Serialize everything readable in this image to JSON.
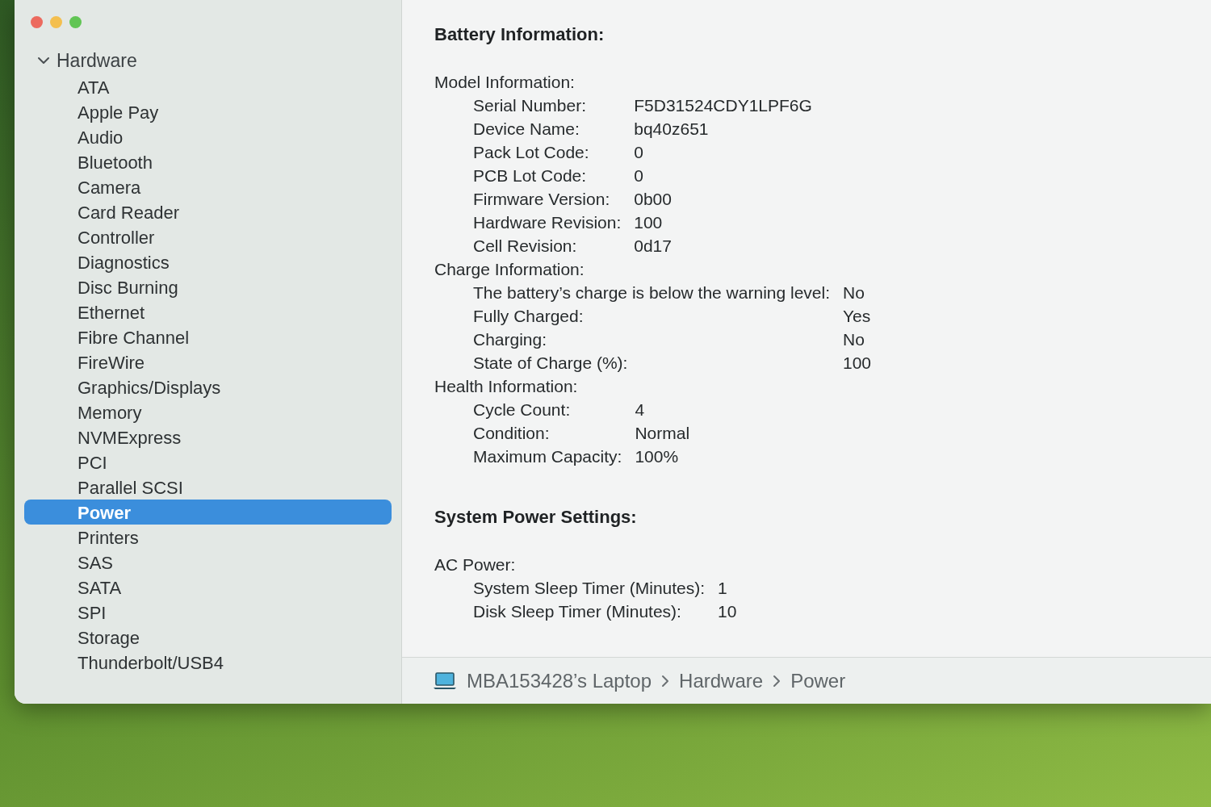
{
  "window_buttons": [
    {
      "color": "#ec6a5e"
    },
    {
      "color": "#f4bf4f"
    },
    {
      "color": "#61c554"
    }
  ],
  "sidebar": {
    "section": {
      "label": "Hardware",
      "expanded": true,
      "children": [
        {
          "label": "ATA",
          "selected": false
        },
        {
          "label": "Apple Pay",
          "selected": false
        },
        {
          "label": "Audio",
          "selected": false
        },
        {
          "label": "Bluetooth",
          "selected": false
        },
        {
          "label": "Camera",
          "selected": false
        },
        {
          "label": "Card Reader",
          "selected": false
        },
        {
          "label": "Controller",
          "selected": false
        },
        {
          "label": "Diagnostics",
          "selected": false
        },
        {
          "label": "Disc Burning",
          "selected": false
        },
        {
          "label": "Ethernet",
          "selected": false
        },
        {
          "label": "Fibre Channel",
          "selected": false
        },
        {
          "label": "FireWire",
          "selected": false
        },
        {
          "label": "Graphics/Displays",
          "selected": false
        },
        {
          "label": "Memory",
          "selected": false
        },
        {
          "label": "NVMExpress",
          "selected": false
        },
        {
          "label": "PCI",
          "selected": false
        },
        {
          "label": "Parallel SCSI",
          "selected": false
        },
        {
          "label": "Power",
          "selected": true
        },
        {
          "label": "Printers",
          "selected": false
        },
        {
          "label": "SAS",
          "selected": false
        },
        {
          "label": "SATA",
          "selected": false
        },
        {
          "label": "SPI",
          "selected": false
        },
        {
          "label": "Storage",
          "selected": false
        },
        {
          "label": "Thunderbolt/USB4",
          "selected": false
        }
      ]
    }
  },
  "details": {
    "sections": [
      {
        "title": "Battery Information:",
        "groups": [
          {
            "label": "Model Information:",
            "rows": [
              {
                "label": "Serial Number:",
                "value": "F5D31524CDY1LPF6G"
              },
              {
                "label": "Device Name:",
                "value": "bq40z651"
              },
              {
                "label": "Pack Lot Code:",
                "value": "0"
              },
              {
                "label": "PCB Lot Code:",
                "value": "0"
              },
              {
                "label": "Firmware Version:",
                "value": "0b00"
              },
              {
                "label": "Hardware Revision:",
                "value": "100"
              },
              {
                "label": "Cell Revision:",
                "value": "0d17"
              }
            ]
          },
          {
            "label": "Charge Information:",
            "rows": [
              {
                "label": "The battery’s charge is below the warning level:",
                "value": "No"
              },
              {
                "label": "Fully Charged:",
                "value": "Yes"
              },
              {
                "label": "Charging:",
                "value": "No"
              },
              {
                "label": "State of Charge (%):",
                "value": "100"
              }
            ]
          },
          {
            "label": "Health Information:",
            "rows": [
              {
                "label": "Cycle Count:",
                "value": "4"
              },
              {
                "label": "Condition:",
                "value": "Normal"
              },
              {
                "label": "Maximum Capacity:",
                "value": "100%"
              }
            ]
          }
        ]
      },
      {
        "title": "System Power Settings:",
        "groups": [
          {
            "label": "AC Power:",
            "rows": [
              {
                "label": "System Sleep Timer (Minutes):",
                "value": "1"
              },
              {
                "label": "Disk Sleep Timer (Minutes):",
                "value": "10"
              }
            ]
          }
        ]
      }
    ]
  },
  "status_bar": {
    "path": [
      "MBA153428’s Laptop",
      "Hardware",
      "Power"
    ]
  }
}
